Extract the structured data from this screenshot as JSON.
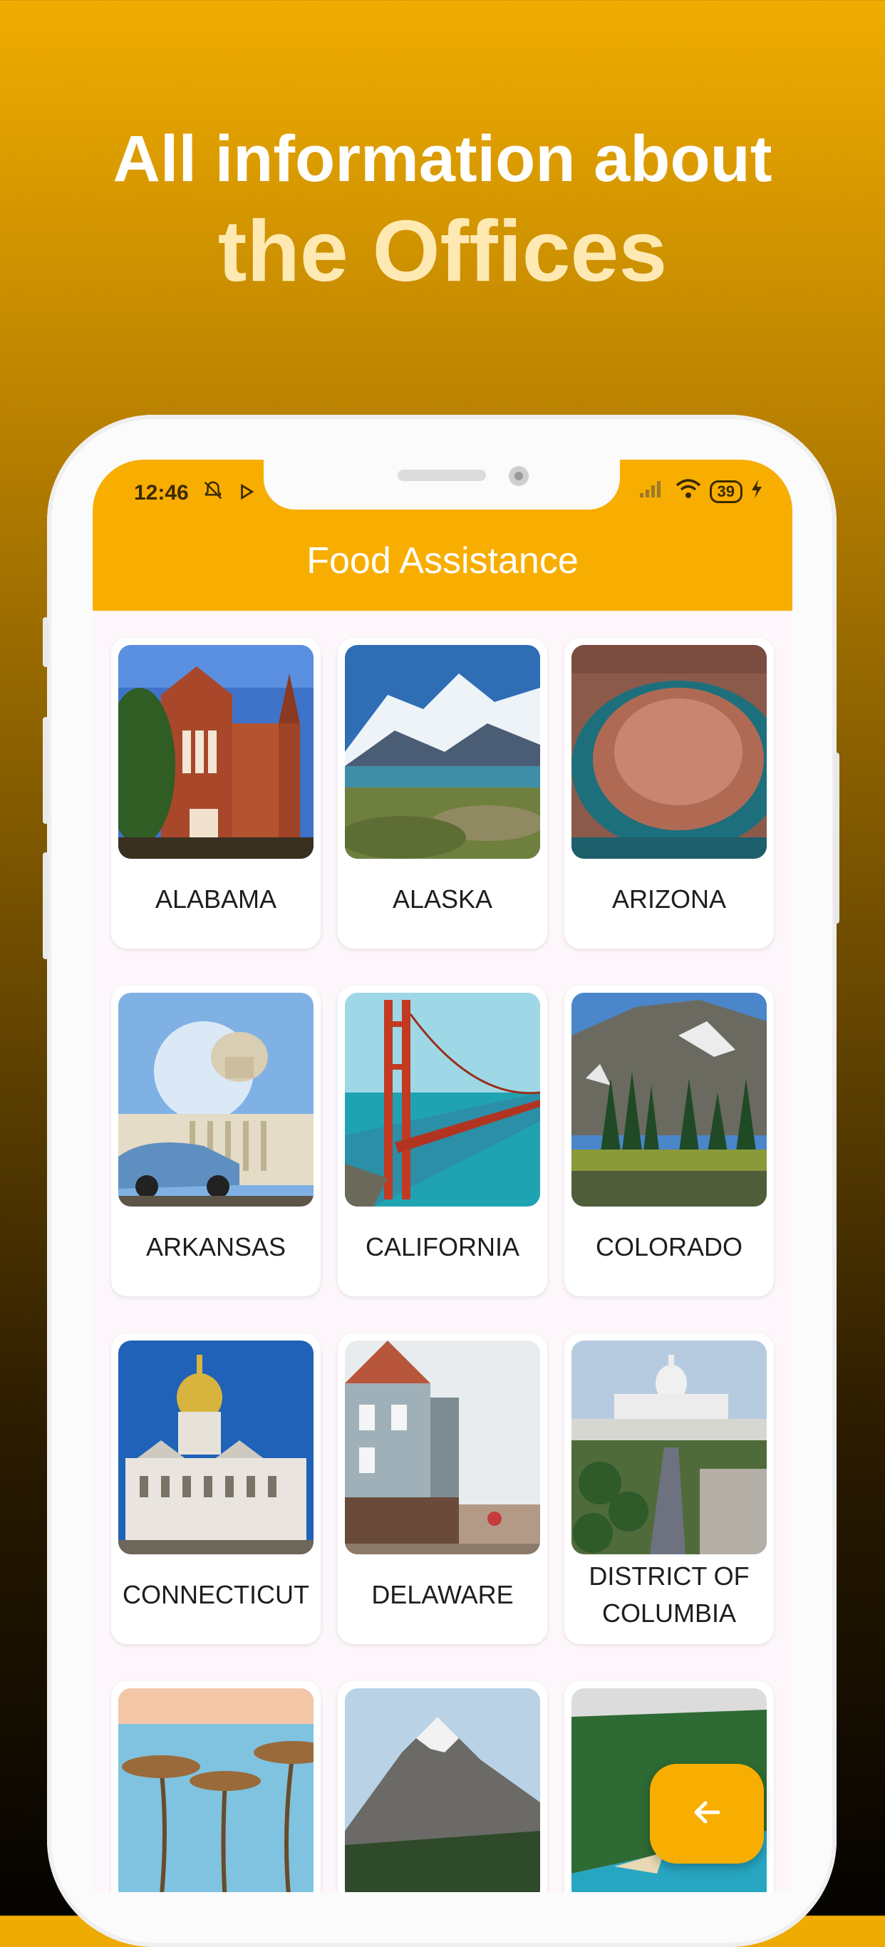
{
  "headline": {
    "line1": "All information about",
    "line2": "the Offices"
  },
  "status_bar": {
    "time": "12:46",
    "battery": "39",
    "left_icons": [
      "alarm-off-icon",
      "play-icon"
    ],
    "right_icons": [
      "signal-icon",
      "wifi-icon",
      "battery-icon",
      "charging-icon"
    ]
  },
  "appbar": {
    "title": "Food Assistance"
  },
  "states": [
    {
      "label": "ALABAMA",
      "image": "brick-building-photo"
    },
    {
      "label": "ALASKA",
      "image": "snowy-mountains-photo"
    },
    {
      "label": "ARIZONA",
      "image": "horseshoe-bend-photo"
    },
    {
      "label": "ARKANSAS",
      "image": "capitol-classic-car-photo"
    },
    {
      "label": "CALIFORNIA",
      "image": "golden-gate-bridge-photo"
    },
    {
      "label": "COLORADO",
      "image": "mountain-forest-photo"
    },
    {
      "label": "CONNECTICUT",
      "image": "state-capitol-photo"
    },
    {
      "label": "DELAWARE",
      "image": "street-storefronts-photo"
    },
    {
      "label": "DISTRICT OF COLUMBIA",
      "image": "us-capitol-avenue-photo"
    },
    {
      "label": "",
      "image": "palm-trees-photo"
    },
    {
      "label": "",
      "image": "snow-peak-photo"
    },
    {
      "label": "",
      "image": "coastal-cliffs-photo"
    }
  ],
  "fab": {
    "icon": "arrow-left-icon"
  },
  "colors": {
    "accent": "#f8ae00",
    "headline_highlight": "#ffe9b3",
    "card_text": "#1e1e1e"
  }
}
